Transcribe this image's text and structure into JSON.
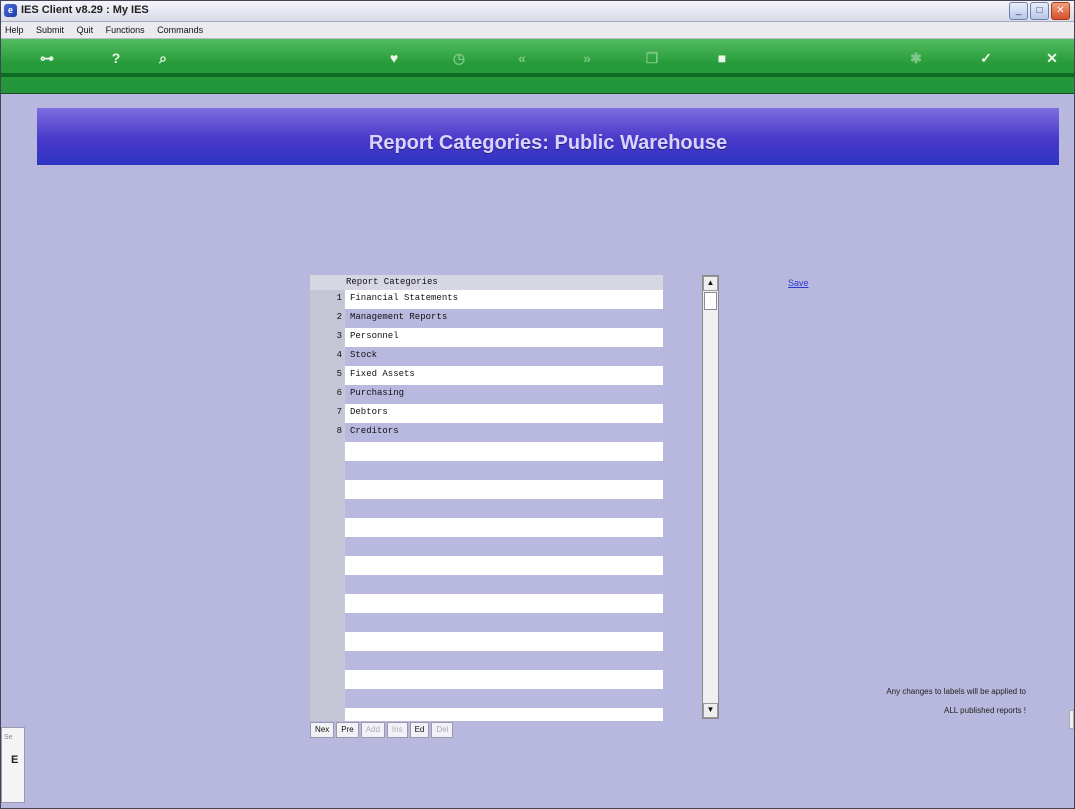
{
  "window": {
    "title": "IES Client v8.29 : My IES"
  },
  "menu": [
    "Help",
    "Submit",
    "Quit",
    "Functions",
    "Commands"
  ],
  "toolbar": {
    "icons": [
      "key-icon",
      "help-icon",
      "search-icon",
      "heart-icon",
      "clock-icon",
      "rewind-icon",
      "forward-icon",
      "copy-icon",
      "stop-icon",
      "gear-icon",
      "check-icon",
      "close-icon"
    ]
  },
  "page": {
    "title": "Report Categories: Public Warehouse"
  },
  "grid": {
    "header": "Report Categories",
    "rows": [
      {
        "num": "1",
        "label": "Financial Statements"
      },
      {
        "num": "2",
        "label": "Management Reports"
      },
      {
        "num": "3",
        "label": "Personnel"
      },
      {
        "num": "4",
        "label": "Stock"
      },
      {
        "num": "5",
        "label": "Fixed Assets"
      },
      {
        "num": "6",
        "label": "Purchasing"
      },
      {
        "num": "7",
        "label": "Debtors"
      },
      {
        "num": "8",
        "label": "Creditors"
      },
      {
        "num": "",
        "label": ""
      },
      {
        "num": "",
        "label": ""
      },
      {
        "num": "",
        "label": ""
      },
      {
        "num": "",
        "label": ""
      },
      {
        "num": "",
        "label": ""
      },
      {
        "num": "",
        "label": ""
      },
      {
        "num": "",
        "label": ""
      },
      {
        "num": "",
        "label": ""
      },
      {
        "num": "",
        "label": ""
      },
      {
        "num": "",
        "label": ""
      },
      {
        "num": "",
        "label": ""
      },
      {
        "num": "",
        "label": ""
      },
      {
        "num": "",
        "label": ""
      },
      {
        "num": "",
        "label": ""
      },
      {
        "num": "",
        "label": ""
      }
    ]
  },
  "actions": {
    "save": "Save"
  },
  "grid_buttons": [
    {
      "label": "Nex",
      "enabled": true
    },
    {
      "label": "Pre",
      "enabled": true
    },
    {
      "label": "Add",
      "enabled": false
    },
    {
      "label": "Ins",
      "enabled": false
    },
    {
      "label": "Ed",
      "enabled": true
    },
    {
      "label": "Del",
      "enabled": false
    }
  ],
  "note": {
    "line1": "Any changes to labels will be applied to",
    "line2": "ALL published reports !"
  },
  "leftstub": {
    "se": "Se",
    "e": "E"
  }
}
